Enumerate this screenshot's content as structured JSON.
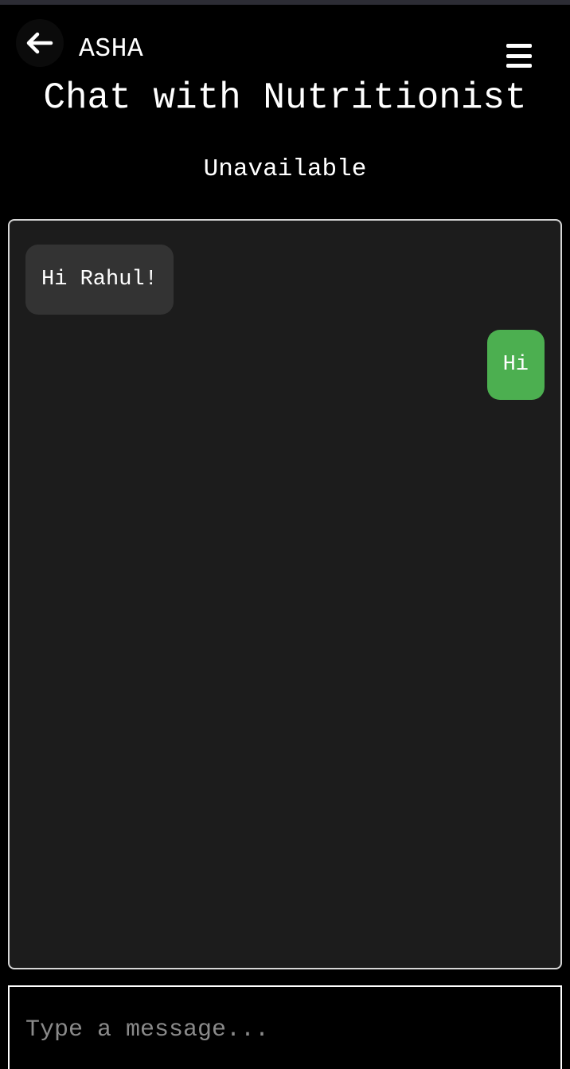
{
  "header": {
    "app_name": "ASHA",
    "back_icon": "arrow-left-icon",
    "menu_icon": "hamburger-menu-icon",
    "title": "Chat with Nutritionist",
    "status": "Unavailable"
  },
  "chat": {
    "messages": [
      {
        "direction": "received",
        "text": "Hi Rahul!"
      },
      {
        "direction": "sent",
        "text": "Hi"
      }
    ]
  },
  "composer": {
    "placeholder": "Type a message..."
  },
  "colors": {
    "background": "#000000",
    "panel": "#1c1c1c",
    "received_bubble": "#333333",
    "sent_bubble": "#4caf50",
    "placeholder": "#8a8a8a"
  }
}
